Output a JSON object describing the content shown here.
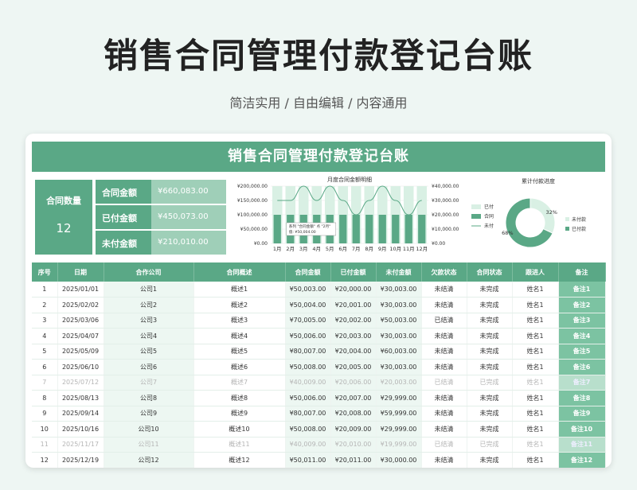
{
  "hero": {
    "title": "销售合同管理付款登记台账",
    "subtitle": "简洁实用 / 自由编辑 / 内容通用"
  },
  "sheet": {
    "banner": "销售合同管理付款登记台账",
    "summary": {
      "count_label": "合同数量",
      "count_value": "12",
      "stats": [
        {
          "label": "合同金额",
          "value": "¥660,083.00"
        },
        {
          "label": "已付金额",
          "value": "¥450,073.00"
        },
        {
          "label": "未付金额",
          "value": "¥210,010.00"
        }
      ]
    },
    "colors": {
      "accent": "#5aa886",
      "accent_light": "#9fcfb8",
      "bar_pale": "#d9f0e4"
    },
    "table": {
      "headers": [
        "序号",
        "日期",
        "合作公司",
        "合同概述",
        "合同金额",
        "已付金额",
        "未付金额",
        "欠款状态",
        "合同状态",
        "跟进人",
        "备注"
      ],
      "rows": [
        [
          "1",
          "2025/01/01",
          "公司1",
          "概述1",
          "¥50,003.00",
          "¥20,000.00",
          "¥30,003.00",
          "未结清",
          "未完成",
          "姓名1",
          "备注1"
        ],
        [
          "2",
          "2025/02/02",
          "公司2",
          "概述2",
          "¥50,004.00",
          "¥20,001.00",
          "¥30,003.00",
          "未结清",
          "未完成",
          "姓名1",
          "备注2"
        ],
        [
          "3",
          "2025/03/06",
          "公司3",
          "概述3",
          "¥70,005.00",
          "¥20,002.00",
          "¥50,003.00",
          "已结清",
          "未完成",
          "姓名1",
          "备注3"
        ],
        [
          "4",
          "2025/04/07",
          "公司4",
          "概述4",
          "¥50,006.00",
          "¥20,003.00",
          "¥30,003.00",
          "未结清",
          "未完成",
          "姓名1",
          "备注4"
        ],
        [
          "5",
          "2025/05/09",
          "公司5",
          "概述5",
          "¥80,007.00",
          "¥20,004.00",
          "¥60,003.00",
          "未结清",
          "未完成",
          "姓名1",
          "备注5"
        ],
        [
          "6",
          "2025/06/10",
          "公司6",
          "概述6",
          "¥50,008.00",
          "¥20,005.00",
          "¥30,003.00",
          "未结清",
          "未完成",
          "姓名1",
          "备注6"
        ],
        [
          "7",
          "2025/07/12",
          "公司7",
          "概述7",
          "¥40,009.00",
          "¥20,006.00",
          "¥20,003.00",
          "已结清",
          "已完成",
          "姓名1",
          "备注7"
        ],
        [
          "8",
          "2025/08/13",
          "公司8",
          "概述8",
          "¥50,006.00",
          "¥20,007.00",
          "¥29,999.00",
          "未结清",
          "未完成",
          "姓名1",
          "备注8"
        ],
        [
          "9",
          "2025/09/14",
          "公司9",
          "概述9",
          "¥80,007.00",
          "¥20,008.00",
          "¥59,999.00",
          "未结清",
          "未完成",
          "姓名1",
          "备注9"
        ],
        [
          "10",
          "2025/10/16",
          "公司10",
          "概述10",
          "¥50,008.00",
          "¥20,009.00",
          "¥29,999.00",
          "未结清",
          "未完成",
          "姓名1",
          "备注10"
        ],
        [
          "11",
          "2025/11/17",
          "公司11",
          "概述11",
          "¥40,009.00",
          "¥20,010.00",
          "¥19,999.00",
          "已结清",
          "已完成",
          "姓名1",
          "备注11"
        ],
        [
          "12",
          "2025/12/19",
          "公司12",
          "概述12",
          "¥50,011.00",
          "¥20,011.00",
          "¥30,000.00",
          "未结清",
          "未完成",
          "姓名1",
          "备注12"
        ]
      ],
      "dim_rows": [
        7,
        11
      ]
    }
  },
  "chart_data": [
    {
      "type": "bar",
      "title": "月度合同金额明细",
      "categories": [
        "1月",
        "2月",
        "3月",
        "4月",
        "5月",
        "6月",
        "7月",
        "8月",
        "9月",
        "10月",
        "11月",
        "12月"
      ],
      "series": [
        {
          "name": "已付金额",
          "type": "bar",
          "axis": "left",
          "values": [
            20000,
            20001,
            20002,
            20003,
            20004,
            20005,
            20006,
            20007,
            20008,
            20009,
            20010,
            20011
          ]
        },
        {
          "name": "合同金额",
          "type": "bar",
          "axis": "right",
          "values": [
            50003,
            50004,
            70005,
            50006,
            80007,
            50008,
            40009,
            50006,
            80007,
            50008,
            40009,
            50011
          ]
        },
        {
          "name": "未付金额",
          "type": "line",
          "axis": "left",
          "values": [
            30003,
            30003,
            50003,
            30003,
            60003,
            30003,
            20003,
            29999,
            59999,
            29999,
            19999,
            30000
          ]
        }
      ],
      "left_axis": {
        "ticks": [
          "¥200,000.00",
          "¥150,000.00",
          "¥100,000.00",
          "¥50,000.00",
          "¥0.00"
        ],
        "ylim": [
          0,
          200000
        ]
      },
      "right_axis": {
        "ticks": [
          "¥40,000.00",
          "¥30,000.00",
          "¥20,000.00",
          "¥10,000.00",
          "¥0.00"
        ],
        "ylim": [
          0,
          40000
        ]
      },
      "legend": [
        "已付金额",
        "合同金额",
        "未付金额"
      ],
      "legend_position": "right",
      "tooltip": [
        "系列 \"合同金额\" 点 \"2月\"",
        "值: ¥50,004.00"
      ]
    },
    {
      "type": "pie",
      "title": "累计付款进度",
      "labels": [
        "未付款",
        "已付款"
      ],
      "values": [
        32,
        68
      ],
      "value_labels": [
        "32%",
        "68%"
      ],
      "colors": [
        "#d9f0e4",
        "#5aa886"
      ],
      "legend_position": "right"
    }
  ]
}
